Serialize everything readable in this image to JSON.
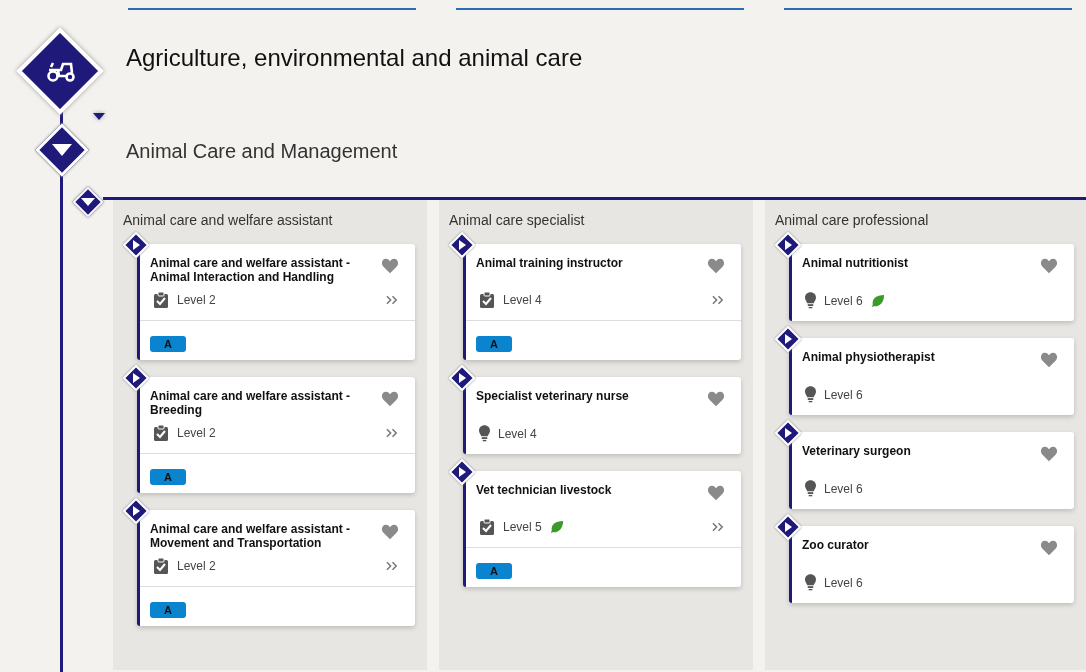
{
  "sector": {
    "title": "Agriculture, environmental and animal care",
    "expanded": true
  },
  "group": {
    "title": "Animal Care and Management",
    "expanded": true
  },
  "columns": [
    {
      "title": "Animal care and welfare assistant",
      "cards": [
        {
          "title": "Animal care and welfare assistant - Animal Interaction and Handling",
          "kind": "apprenticeship",
          "level": "Level 2",
          "green": false,
          "more": true,
          "badges": [
            "A"
          ]
        },
        {
          "title": "Animal care and welfare assistant - Breeding",
          "kind": "apprenticeship",
          "level": "Level 2",
          "green": false,
          "more": true,
          "badges": [
            "A"
          ]
        },
        {
          "title": "Animal care and welfare assistant - Movement and Transportation",
          "kind": "apprenticeship",
          "level": "Level 2",
          "green": false,
          "more": true,
          "badges": [
            "A"
          ]
        }
      ]
    },
    {
      "title": "Animal care specialist",
      "cards": [
        {
          "title": "Animal training instructor",
          "kind": "apprenticeship",
          "level": "Level 4",
          "green": false,
          "more": true,
          "badges": [
            "A"
          ]
        },
        {
          "title": "Specialist veterinary nurse",
          "kind": "idea",
          "level": "Level 4",
          "green": false,
          "more": false
        },
        {
          "title": "Vet technician livestock",
          "kind": "apprenticeship",
          "level": "Level 5",
          "green": true,
          "more": true,
          "badges": [
            "A"
          ]
        }
      ]
    },
    {
      "title": "Animal care professional",
      "cards": [
        {
          "title": "Animal nutritionist",
          "kind": "idea",
          "level": "Level 6",
          "green": true,
          "more": false
        },
        {
          "title": "Animal physiotherapist",
          "kind": "idea",
          "level": "Level 6",
          "green": false,
          "more": false
        },
        {
          "title": "Veterinary surgeon",
          "kind": "idea",
          "level": "Level 6",
          "green": false,
          "more": false
        },
        {
          "title": "Zoo curator",
          "kind": "idea",
          "level": "Level 6",
          "green": false,
          "more": false
        }
      ]
    }
  ]
}
